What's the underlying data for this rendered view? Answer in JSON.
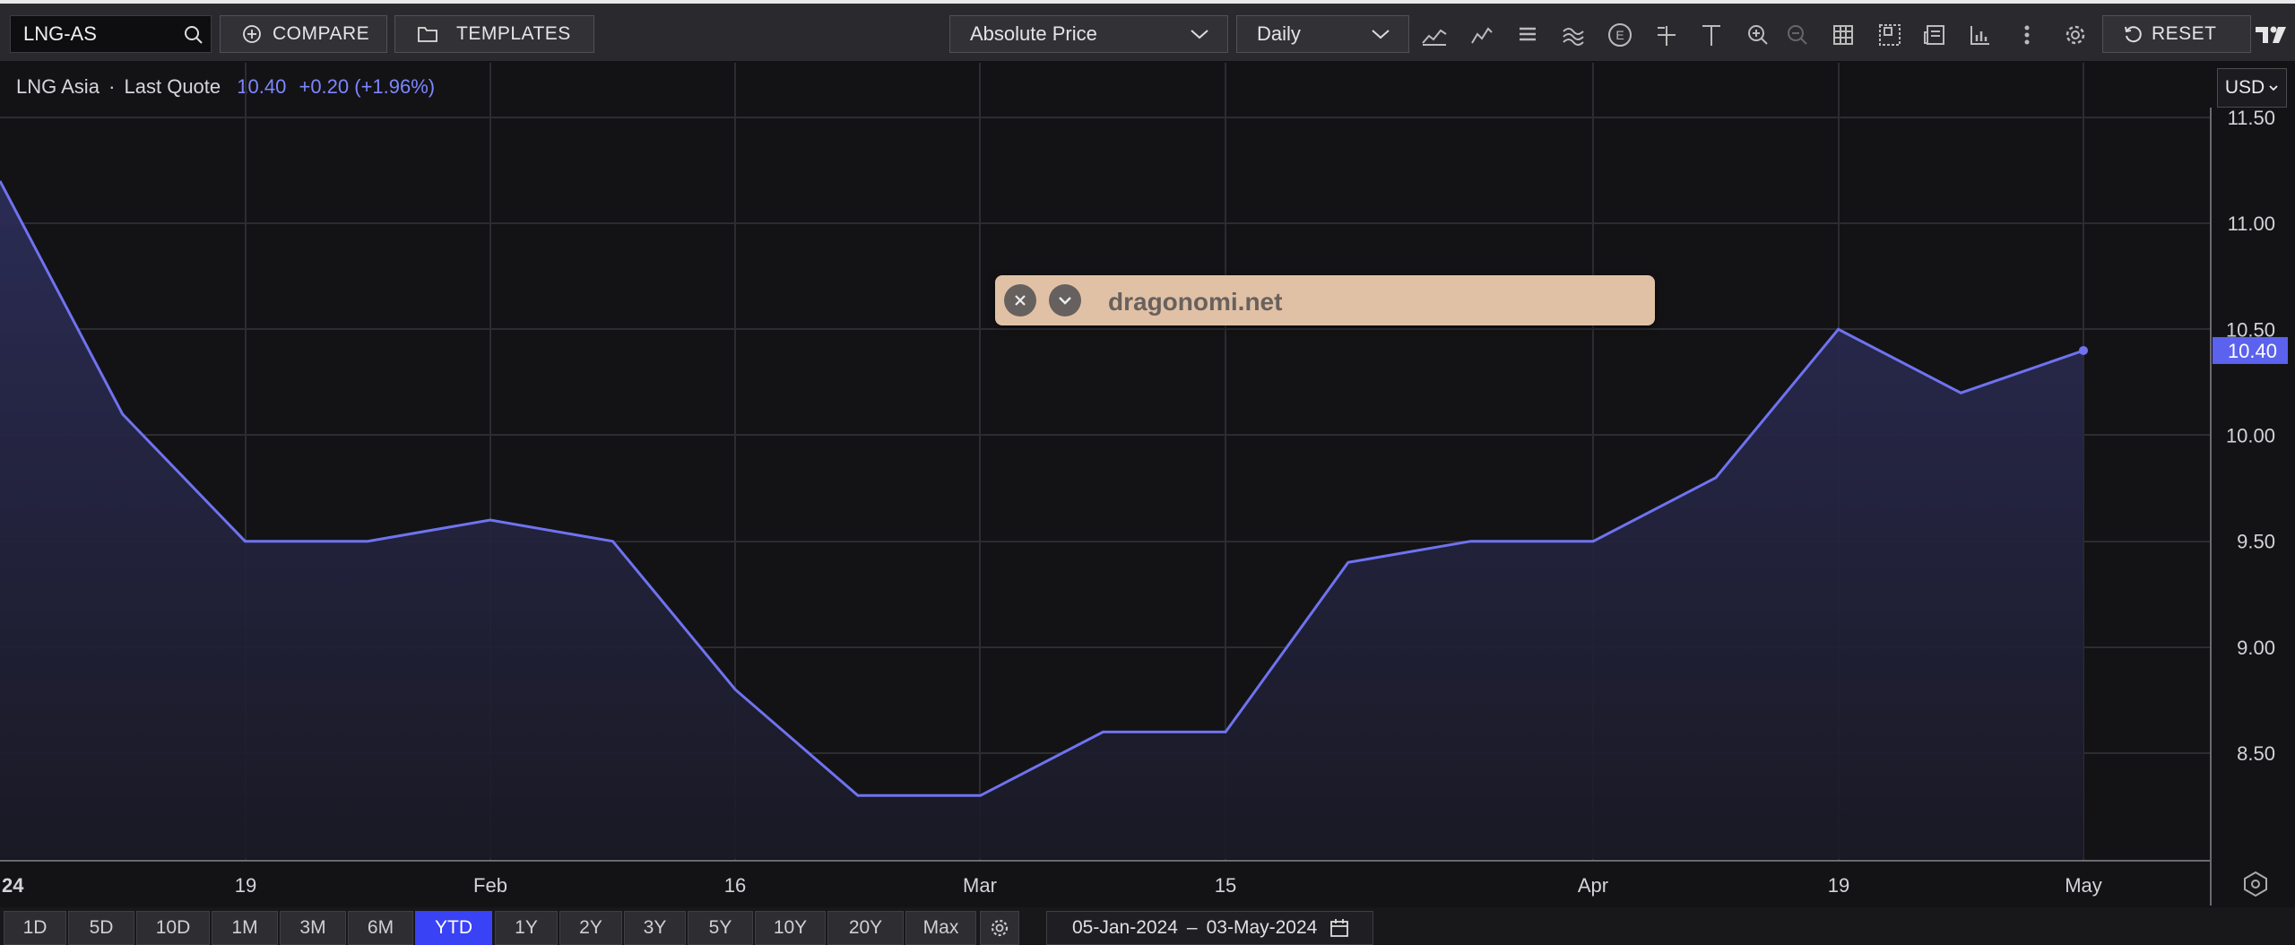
{
  "toolbar": {
    "symbol": "LNG-AS",
    "compare_label": "COMPARE",
    "templates_label": "TEMPLATES",
    "price_mode": "Absolute Price",
    "interval": "Daily",
    "reset_label": "RESET",
    "tools": [
      "chart-style-icon",
      "indicators-icon",
      "studies-icon",
      "drawings-icon",
      "events-icon",
      "crosshair-icon",
      "text-icon",
      "zoom-in-icon",
      "zoom-out-icon",
      "table-icon",
      "layout-icon",
      "news-icon",
      "stats-icon",
      "more-icon",
      "settings-icon"
    ]
  },
  "quote": {
    "name": "LNG Asia",
    "separator": "·",
    "label": "Last Quote",
    "last": "10.40",
    "change": "+0.20 (+1.96%)"
  },
  "currency": "USD",
  "popup": {
    "text": "dragonomi.net"
  },
  "colors": {
    "line": "#6f73f0",
    "accent": "#3942f4",
    "background": "#131316"
  },
  "chart_data": {
    "type": "area",
    "x": [
      "2024-01-05",
      "2024-01-12",
      "2024-01-19",
      "2024-01-26",
      "2024-02-02",
      "2024-02-09",
      "2024-02-16",
      "2024-02-23",
      "2024-03-01",
      "2024-03-08",
      "2024-03-15",
      "2024-03-22",
      "2024-03-29",
      "2024-04-05",
      "2024-04-12",
      "2024-04-19",
      "2024-04-26",
      "2024-05-03"
    ],
    "values": [
      11.2,
      10.1,
      9.5,
      9.5,
      9.6,
      9.5,
      8.8,
      8.3,
      8.3,
      8.6,
      8.6,
      9.4,
      9.5,
      9.5,
      9.8,
      10.5,
      10.2,
      10.4
    ],
    "x_ticks": [
      "24",
      "19",
      "Feb",
      "16",
      "Mar",
      "15",
      "Apr",
      "19",
      "May"
    ],
    "y_ticks": [
      "11.50",
      "11.00",
      "10.50",
      "10.00",
      "9.50",
      "9.00",
      "8.50"
    ],
    "ylim": [
      8.0,
      11.5
    ],
    "last_value_label": "10.40",
    "grid": true,
    "legend": "none"
  },
  "range_buttons": [
    "1D",
    "5D",
    "10D",
    "1M",
    "3M",
    "6M",
    "YTD",
    "1Y",
    "2Y",
    "3Y",
    "5Y",
    "10Y",
    "20Y",
    "Max"
  ],
  "active_range": "YTD",
  "date_range": {
    "start": "05-Jan-2024",
    "sep": "–",
    "end": "03-May-2024"
  }
}
